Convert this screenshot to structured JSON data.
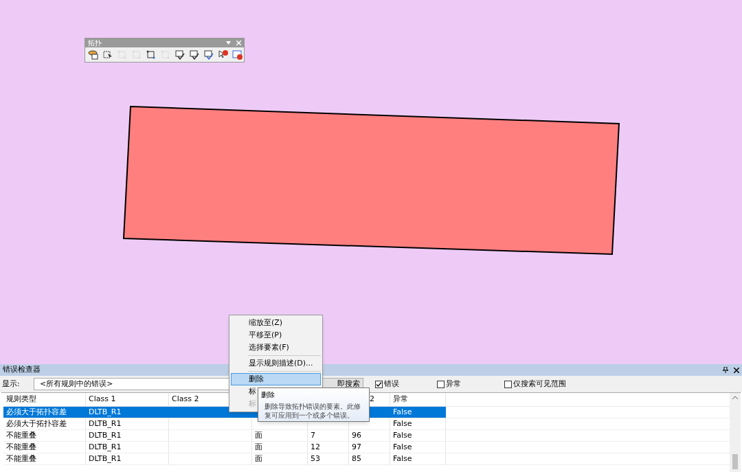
{
  "toolbar": {
    "title": "拓扑",
    "tools": [
      {
        "kind": "database",
        "disabled": false
      },
      {
        "kind": "select",
        "disabled": false
      },
      {
        "kind": "edge",
        "disabled": true
      },
      {
        "kind": "vertex",
        "disabled": true
      },
      {
        "kind": "split",
        "disabled": false
      },
      {
        "kind": "align",
        "disabled": true
      },
      {
        "kind": "validate",
        "disabled": false
      },
      {
        "kind": "validate-extent",
        "disabled": false
      },
      {
        "kind": "validate-check",
        "disabled": false
      },
      {
        "kind": "fix",
        "disabled": false
      },
      {
        "kind": "inspector",
        "disabled": false
      }
    ]
  },
  "context_menu": {
    "items": [
      {
        "kind": "item",
        "label": "缩放至(Z)",
        "selected": false,
        "disabled": false
      },
      {
        "kind": "item",
        "label": "平移至(P)",
        "selected": false,
        "disabled": false
      },
      {
        "kind": "item",
        "label": "选择要素(F)",
        "selected": false,
        "disabled": false
      },
      {
        "kind": "separator"
      },
      {
        "kind": "item",
        "label": "显示规则描述(D)...",
        "selected": false,
        "disabled": false
      },
      {
        "kind": "separator"
      },
      {
        "kind": "item",
        "label": "删除",
        "selected": true,
        "disabled": false
      },
      {
        "kind": "item",
        "label": "标",
        "selected": false,
        "disabled": false
      },
      {
        "kind": "item",
        "label": "标",
        "selected": false,
        "disabled": true
      }
    ]
  },
  "tooltip": {
    "title": "删除",
    "text": "删除导致拓扑错误的要素。此修复可应用到一个或多个错误。"
  },
  "panel": {
    "title": "错误检查器",
    "show_label": "显示:",
    "show_value": "<所有规则中的错误>",
    "search_button": "即搜索",
    "checkboxes": [
      {
        "label": "错误",
        "checked": true
      },
      {
        "label": "异常",
        "checked": false
      },
      {
        "label": "仅搜索可见范围",
        "checked": false
      }
    ],
    "table": {
      "columns": [
        "规则类型",
        "Class 1",
        "Class 2",
        null,
        null,
        "2",
        "异常"
      ],
      "rows": [
        {
          "selected": true,
          "cells": [
            "必须大于拓扑容差",
            "DLTB_R1",
            null,
            null,
            null,
            null,
            "False"
          ]
        },
        {
          "selected": false,
          "cells": [
            "必须大于拓扑容差",
            "DLTB_R1",
            null,
            null,
            null,
            null,
            "False"
          ]
        },
        {
          "selected": false,
          "cells": [
            "不能重叠",
            "DLTB_R1",
            null,
            "面",
            "7",
            "96",
            "False"
          ]
        },
        {
          "selected": false,
          "cells": [
            "不能重叠",
            "DLTB_R1",
            null,
            "面",
            "12",
            "97",
            "False"
          ]
        },
        {
          "selected": false,
          "cells": [
            "不能重叠",
            "DLTB_R1",
            null,
            "面",
            "53",
            "85",
            "False"
          ]
        }
      ]
    }
  }
}
